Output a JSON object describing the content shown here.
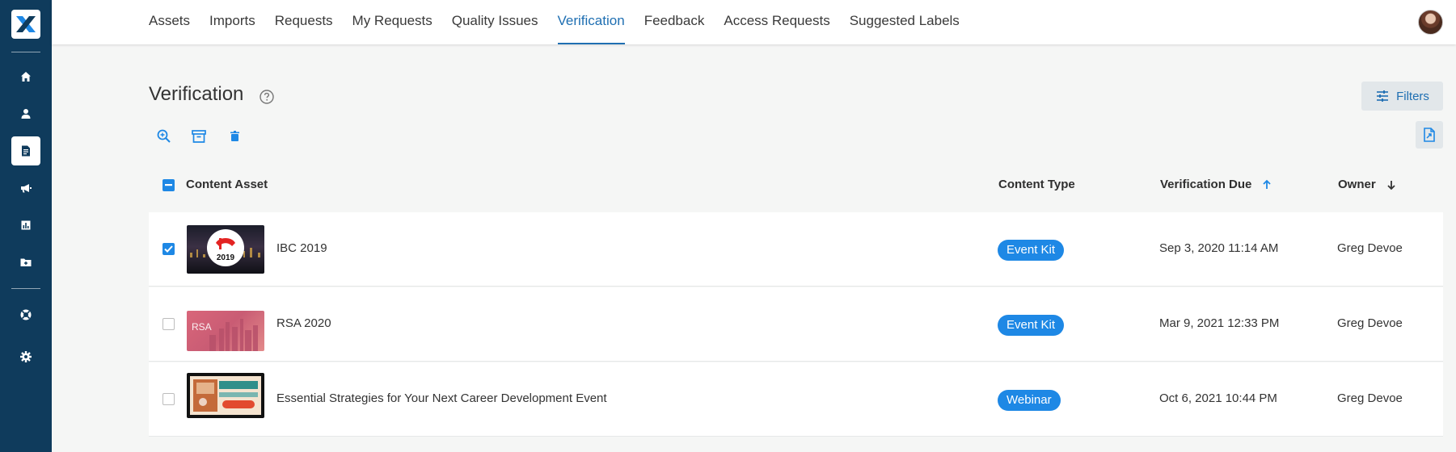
{
  "sidebar": {
    "items": [
      {
        "icon": "home-icon"
      },
      {
        "icon": "person-icon"
      },
      {
        "icon": "document-icon"
      },
      {
        "icon": "megaphone-icon"
      },
      {
        "icon": "bar-chart-icon"
      },
      {
        "icon": "folder-icon"
      },
      {
        "icon": "help-ring-icon"
      },
      {
        "icon": "gear-icon"
      }
    ],
    "active_index": 2
  },
  "topnav": {
    "tabs": [
      "Assets",
      "Imports",
      "Requests",
      "My Requests",
      "Quality Issues",
      "Verification",
      "Feedback",
      "Access Requests",
      "Suggested Labels"
    ],
    "active": "Verification"
  },
  "page": {
    "title": "Verification",
    "filters_label": "Filters"
  },
  "table": {
    "columns": {
      "asset": "Content Asset",
      "type": "Content Type",
      "due": "Verification Due",
      "owner": "Owner"
    },
    "rows": [
      {
        "name": "IBC 2019",
        "type": "Event Kit",
        "due": "Sep 3, 2020 11:14 AM",
        "owner": "Greg Devoe",
        "checked": true,
        "thumb_text": "2019"
      },
      {
        "name": "RSA 2020",
        "type": "Event Kit",
        "due": "Mar 9, 2021 12:33 PM",
        "owner": "Greg Devoe",
        "checked": false,
        "thumb_text": "RSA"
      },
      {
        "name": "Essential Strategies for Your Next Career Development Event",
        "type": "Webinar",
        "due": "Oct 6, 2021 10:44 PM",
        "owner": "Greg Devoe",
        "checked": false
      }
    ]
  },
  "colors": {
    "sidebar": "#0f3b5c",
    "accent": "#1e88e5",
    "active_tab": "#1f6fb2"
  }
}
